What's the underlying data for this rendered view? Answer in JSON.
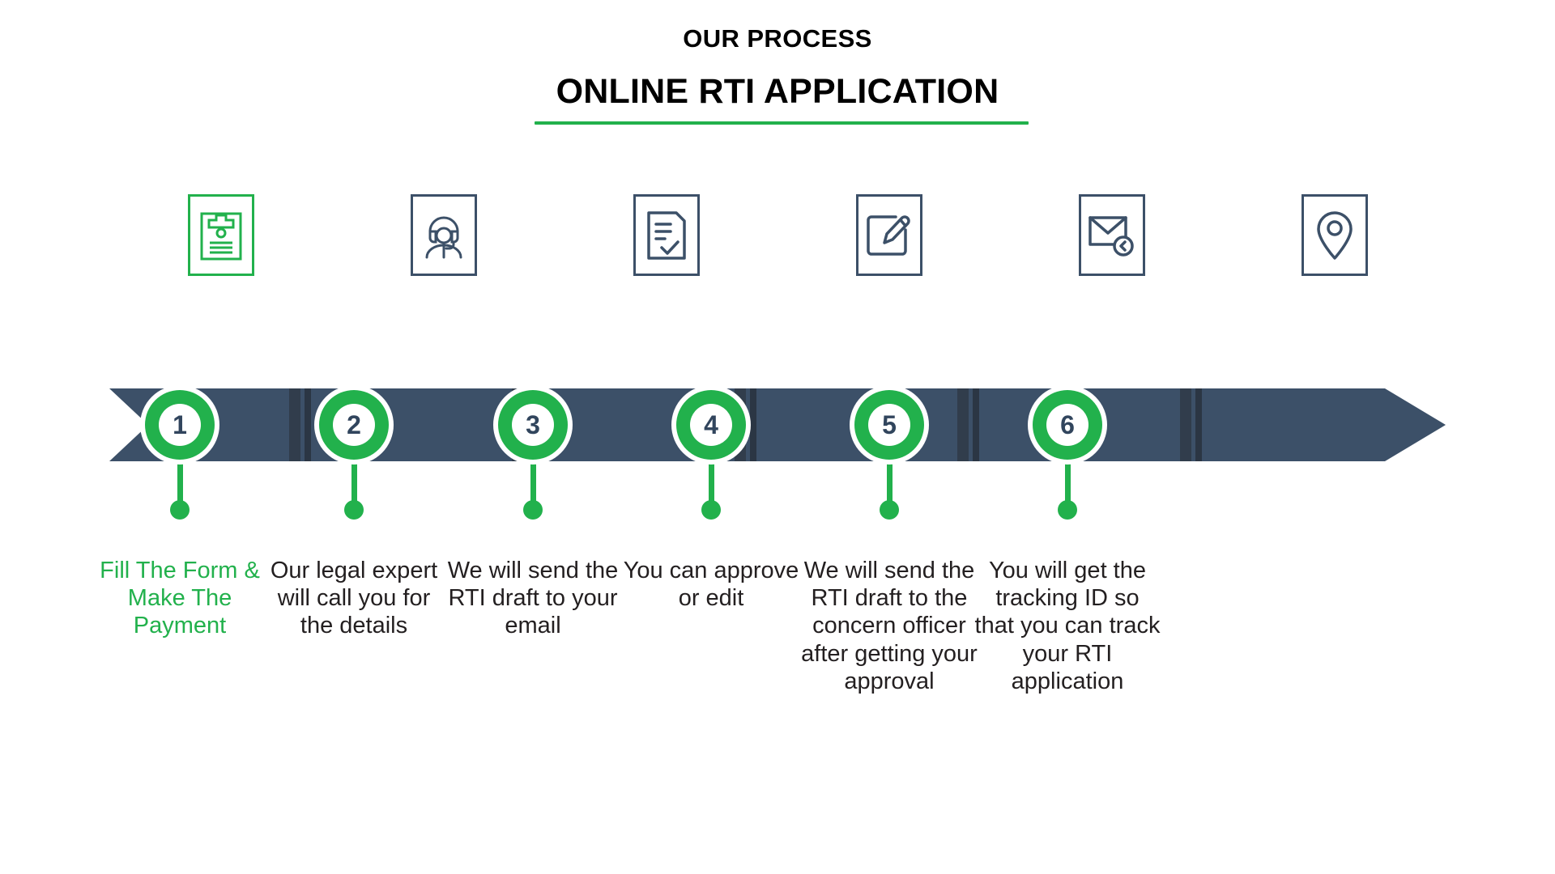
{
  "header": {
    "eyebrow": "OUR PROCESS",
    "title": "ONLINE RTI APPLICATION"
  },
  "colors": {
    "accent_green": "#22b14c",
    "navy": "#3c5068",
    "banner_stripe": "#313d4c",
    "text_dark": "#231f20",
    "background": "#ffffff"
  },
  "steps": [
    {
      "number": "1",
      "icon": "clipboard-form-icon",
      "caption": "Fill The Form & Make The Payment",
      "active": true
    },
    {
      "number": "2",
      "icon": "support-agent-headset-icon",
      "caption": "Our legal expert will call you for the details",
      "active": false
    },
    {
      "number": "3",
      "icon": "document-checkmark-icon",
      "caption": "We will send the RTI draft to your email",
      "active": false
    },
    {
      "number": "4",
      "icon": "edit-pencil-square-icon",
      "caption": "You can approve or edit",
      "active": false
    },
    {
      "number": "5",
      "icon": "envelope-send-icon",
      "caption": "We will send the RTI draft to the concern officer after getting your approval",
      "active": false
    },
    {
      "number": "6",
      "icon": "location-pin-tracking-icon",
      "caption": "You will get the tracking ID so that you can track your RTI application",
      "active": false
    }
  ]
}
